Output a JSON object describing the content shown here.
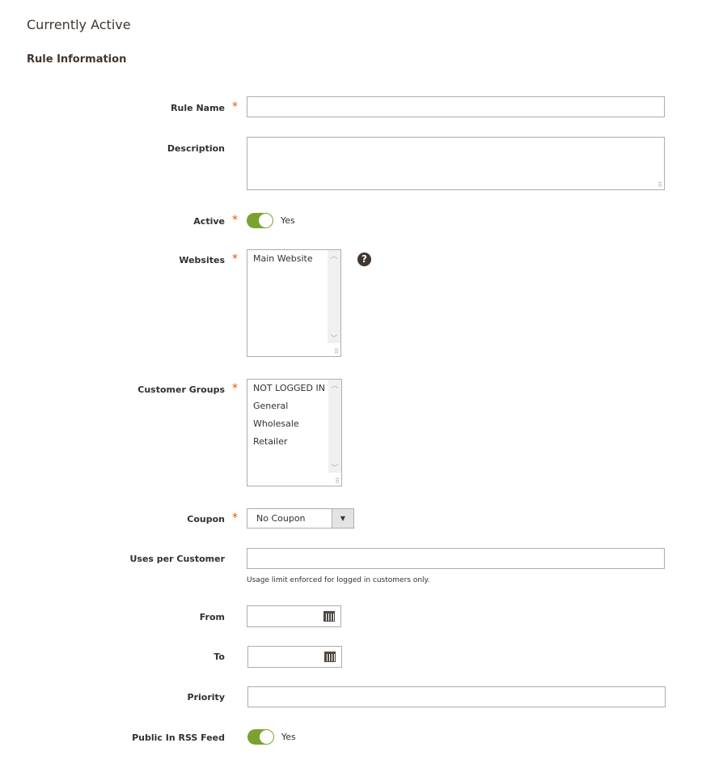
{
  "page_title": "Currently Active",
  "section_title": "Rule Information",
  "fields": {
    "rule_name": {
      "label": "Rule Name",
      "value": ""
    },
    "description": {
      "label": "Description",
      "value": ""
    },
    "active": {
      "label": "Active",
      "state": "Yes",
      "on": true
    },
    "websites": {
      "label": "Websites",
      "options": [
        "Main Website"
      ],
      "help_icon": "question-circle-icon"
    },
    "customer_groups": {
      "label": "Customer Groups",
      "options": [
        "NOT LOGGED IN",
        "General",
        "Wholesale",
        "Retailer"
      ]
    },
    "coupon": {
      "label": "Coupon",
      "selected": "No Coupon"
    },
    "uses_per_customer": {
      "label": "Uses per Customer",
      "value": "",
      "hint": "Usage limit enforced for logged in customers only."
    },
    "from": {
      "label": "From",
      "value": ""
    },
    "to": {
      "label": "To",
      "value": ""
    },
    "priority": {
      "label": "Priority",
      "value": ""
    },
    "rss": {
      "label": "Public In RSS Feed",
      "state": "Yes",
      "on": true
    }
  },
  "colors": {
    "accent": "#79a22e",
    "required": "#eb5202"
  }
}
